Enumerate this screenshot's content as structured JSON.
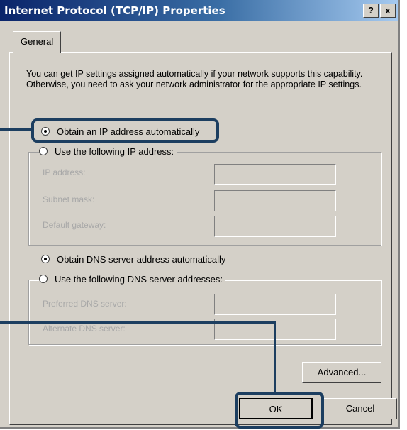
{
  "window": {
    "title": "Internet Protocol (TCP/IP) Properties",
    "help_label": "?",
    "close_label": "x"
  },
  "tabs": [
    {
      "label": "General",
      "active": true
    }
  ],
  "description": "You can get IP settings assigned automatically if your network supports this capability. Otherwise, you need to ask your network administrator for the appropriate IP settings.",
  "ip": {
    "auto_label": "Obtain an IP address automatically",
    "auto_selected": true,
    "manual_label": "Use the following IP address:",
    "fields": [
      {
        "label": "IP address:",
        "value": ""
      },
      {
        "label": "Subnet mask:",
        "value": ""
      },
      {
        "label": "Default gateway:",
        "value": ""
      }
    ]
  },
  "dns": {
    "auto_label": "Obtain DNS server address automatically",
    "auto_selected": true,
    "manual_label": "Use the following DNS server addresses:",
    "fields": [
      {
        "label": "Preferred DNS server:",
        "value": ""
      },
      {
        "label": "Alternate DNS server:",
        "value": ""
      }
    ]
  },
  "buttons": {
    "advanced": "Advanced...",
    "ok": "OK",
    "cancel": "Cancel"
  },
  "colors": {
    "titlebar_start": "#0a246a",
    "dialog_face": "#d4d0c8",
    "highlight": "#1c3e60"
  }
}
